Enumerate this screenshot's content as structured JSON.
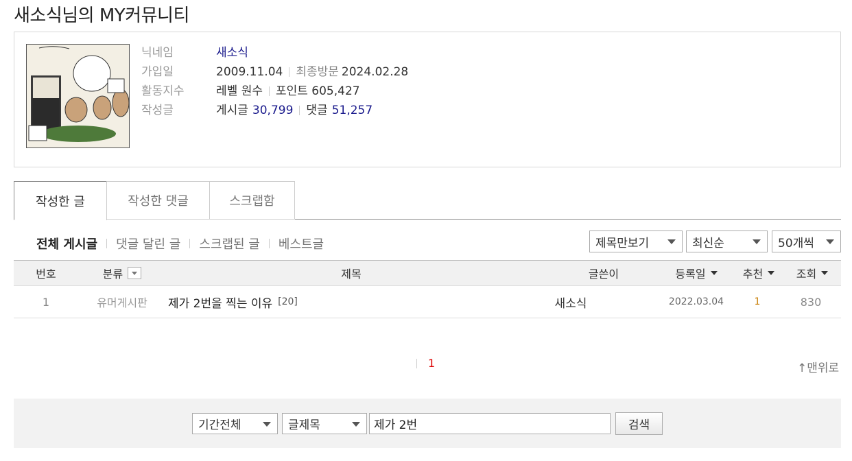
{
  "page": {
    "title": "새소식님의 MY커뮤니티"
  },
  "profile": {
    "labels": {
      "nickname": "닉네임",
      "joined": "가입일",
      "activity": "활동지수",
      "posts": "작성글"
    },
    "nickname": "새소식",
    "join_date": "2009.11.04",
    "last_visit_label": "최종방문",
    "last_visit": "2024.02.28",
    "level_label": "레벨",
    "level": "원수",
    "point_label": "포인트",
    "points": "605,427",
    "post_label": "게시글",
    "post_count": "30,799",
    "comment_label": "댓글",
    "comment_count": "51,257"
  },
  "tabs": [
    "작성한 글",
    "작성한 댓글",
    "스크랩함"
  ],
  "filters": [
    "전체 게시글",
    "댓글 달린 글",
    "스크랩된 글",
    "베스트글"
  ],
  "selects": {
    "view_mode": "제목만보기",
    "sort": "최신순",
    "per_page": "50개씩"
  },
  "table": {
    "headers": {
      "num": "번호",
      "category": "분류",
      "title": "제목",
      "writer": "글쓴이",
      "date": "등록일",
      "recommend": "추천",
      "views": "조회"
    },
    "rows": [
      {
        "num": "1",
        "category": "유머게시판",
        "title": "제가 2번을 찍는 이유",
        "comments": "[20]",
        "writer": "새소식",
        "date": "2022.03.04",
        "recommend": "1",
        "views": "830"
      }
    ]
  },
  "pagination": {
    "current": "1"
  },
  "to_top": "↑맨위로",
  "search": {
    "period": "기간전체",
    "field": "글제목",
    "query": "제가 2번",
    "button": "검색"
  },
  "colors": {
    "link_blue": "#1a1a8c",
    "current_page_red": "#dd0000",
    "recommend_orange": "#c77c00"
  }
}
